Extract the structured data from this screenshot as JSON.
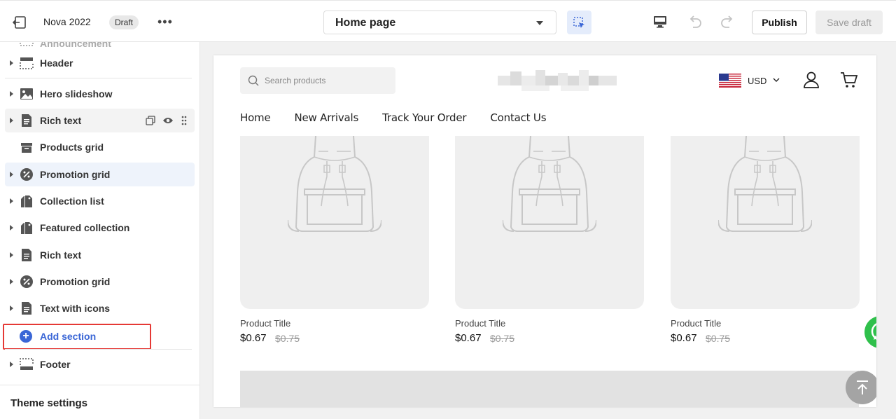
{
  "topbar": {
    "site_title": "Nova 2022",
    "status_badge": "Draft",
    "more_label": "•••",
    "page_select": "Home page",
    "publish_label": "Publish",
    "save_draft_label": "Save draft"
  },
  "sidebar": {
    "cut_item": "Announcement",
    "items": [
      {
        "label": "Header",
        "icon": "header-layout-icon"
      },
      {
        "label": "Hero slideshow",
        "icon": "image-icon"
      },
      {
        "label": "Rich text",
        "icon": "document-icon"
      },
      {
        "label": "Products grid",
        "icon": "box-icon"
      },
      {
        "label": "Promotion grid",
        "icon": "percent-badge-icon"
      },
      {
        "label": "Collection list",
        "icon": "tags-icon"
      },
      {
        "label": "Featured collection",
        "icon": "tags-icon"
      },
      {
        "label": "Rich text",
        "icon": "document-icon"
      },
      {
        "label": "Promotion grid",
        "icon": "percent-badge-icon"
      },
      {
        "label": "Text with icons",
        "icon": "document-icon"
      }
    ],
    "add_section_label": "Add section",
    "footer_label": "Footer",
    "theme_settings_label": "Theme settings"
  },
  "store": {
    "search_placeholder": "Search products",
    "currency": "USD",
    "nav": [
      "Home",
      "New Arrivals",
      "Track Your Order",
      "Contact Us"
    ],
    "products": [
      {
        "title": "Product Title",
        "price": "$0.67",
        "compare_price": "$0.75"
      },
      {
        "title": "Product Title",
        "price": "$0.67",
        "compare_price": "$0.75"
      },
      {
        "title": "Product Title",
        "price": "$0.67",
        "compare_price": "$0.75"
      }
    ]
  },
  "colors": {
    "accent": "#3a66d6",
    "highlight_border": "#e53935",
    "whatsapp": "#2fc04b"
  }
}
